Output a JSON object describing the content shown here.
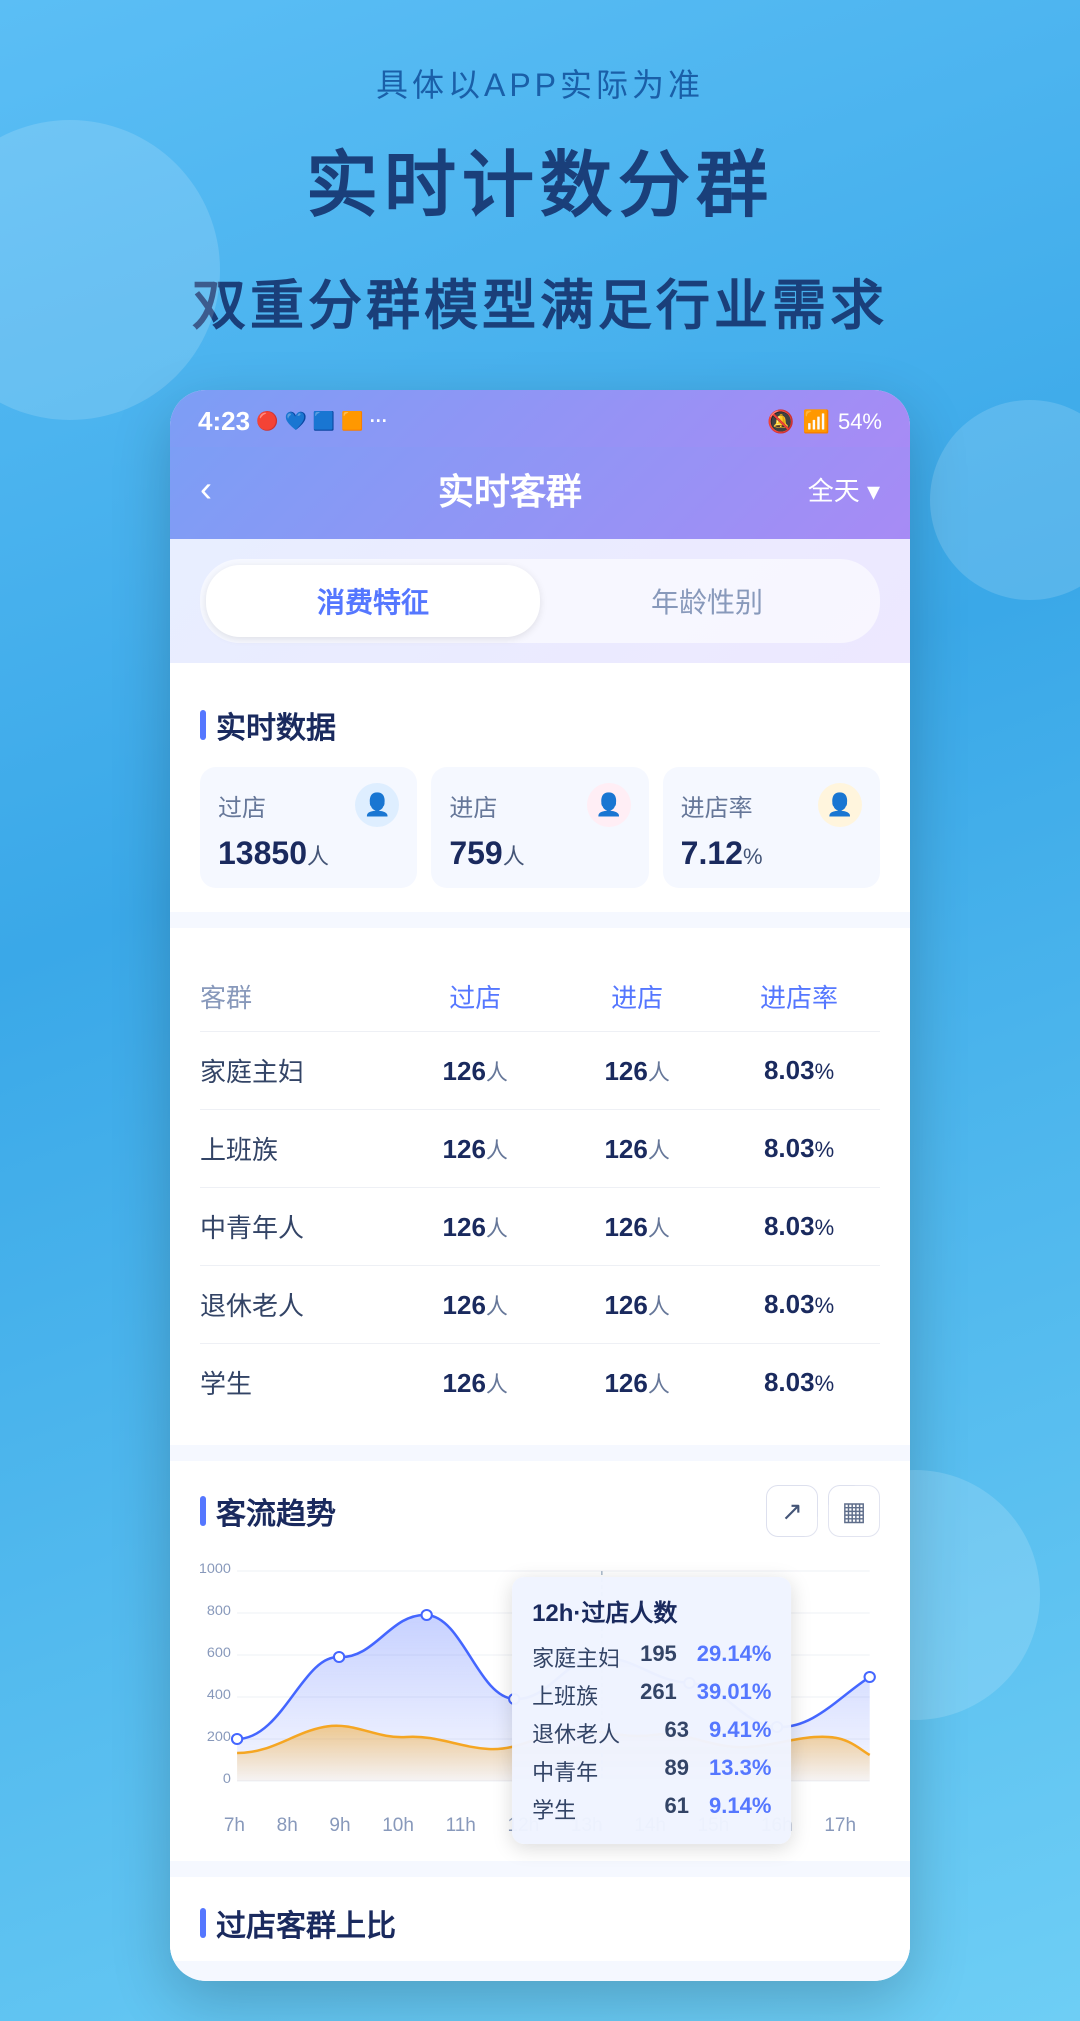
{
  "page": {
    "subtitle": "具体以APP实际为准",
    "main_title": "实时计数分群",
    "sub_title": "双重分群模型满足行业需求"
  },
  "status_bar": {
    "time": "4:23",
    "battery": "54%"
  },
  "header": {
    "back_label": "‹",
    "title": "实时客群",
    "filter_label": "全天 ▾"
  },
  "tabs": [
    {
      "id": "consume",
      "label": "消费特征",
      "active": true
    },
    {
      "id": "age",
      "label": "年龄性别",
      "active": false
    }
  ],
  "realtime_section": {
    "title": "实时数据",
    "cards": [
      {
        "label": "过店",
        "value": "13850",
        "unit": "人",
        "icon_color": "blue"
      },
      {
        "label": "进店",
        "value": "759",
        "unit": "人",
        "icon_color": "pink"
      },
      {
        "label": "进店率",
        "value": "7.12",
        "unit": "%",
        "icon_color": "yellow"
      }
    ]
  },
  "table": {
    "headers": [
      "客群",
      "过店",
      "进店",
      "进店率"
    ],
    "rows": [
      {
        "group": "家庭主妇",
        "pass": "126",
        "enter": "126",
        "rate": "8.03"
      },
      {
        "group": "上班族",
        "pass": "126",
        "enter": "126",
        "rate": "8.03"
      },
      {
        "group": "中青年人",
        "pass": "126",
        "enter": "126",
        "rate": "8.03"
      },
      {
        "group": "退休老人",
        "pass": "126",
        "enter": "126",
        "rate": "8.03"
      },
      {
        "group": "学生",
        "pass": "126",
        "enter": "126",
        "rate": "8.03"
      }
    ]
  },
  "chart_section": {
    "title": "客流趋势",
    "y_max": "1000",
    "y_800": "800",
    "y_600": "600",
    "y_400": "400",
    "y_200": "200",
    "y_0": "0",
    "x_labels": [
      "7h",
      "8h",
      "9h",
      "10h",
      "11h",
      "12h",
      "13h",
      "14h",
      "15h",
      "16h",
      "17h"
    ],
    "tooltip": {
      "title": "12h·过店人数",
      "rows": [
        {
          "name": "家庭主妇",
          "value": "195",
          "pct": "29.14%"
        },
        {
          "name": "上班族",
          "value": "261",
          "pct": "39.01%"
        },
        {
          "name": "退休老人",
          "value": "63",
          "pct": "9.41%"
        },
        {
          "name": "中青年",
          "value": "89",
          "pct": "13.3%"
        },
        {
          "name": "学生",
          "value": "61",
          "pct": "9.14%"
        }
      ]
    },
    "btn1": "↗",
    "btn2": "▦"
  },
  "bottom_section_title": "过店客群上比"
}
